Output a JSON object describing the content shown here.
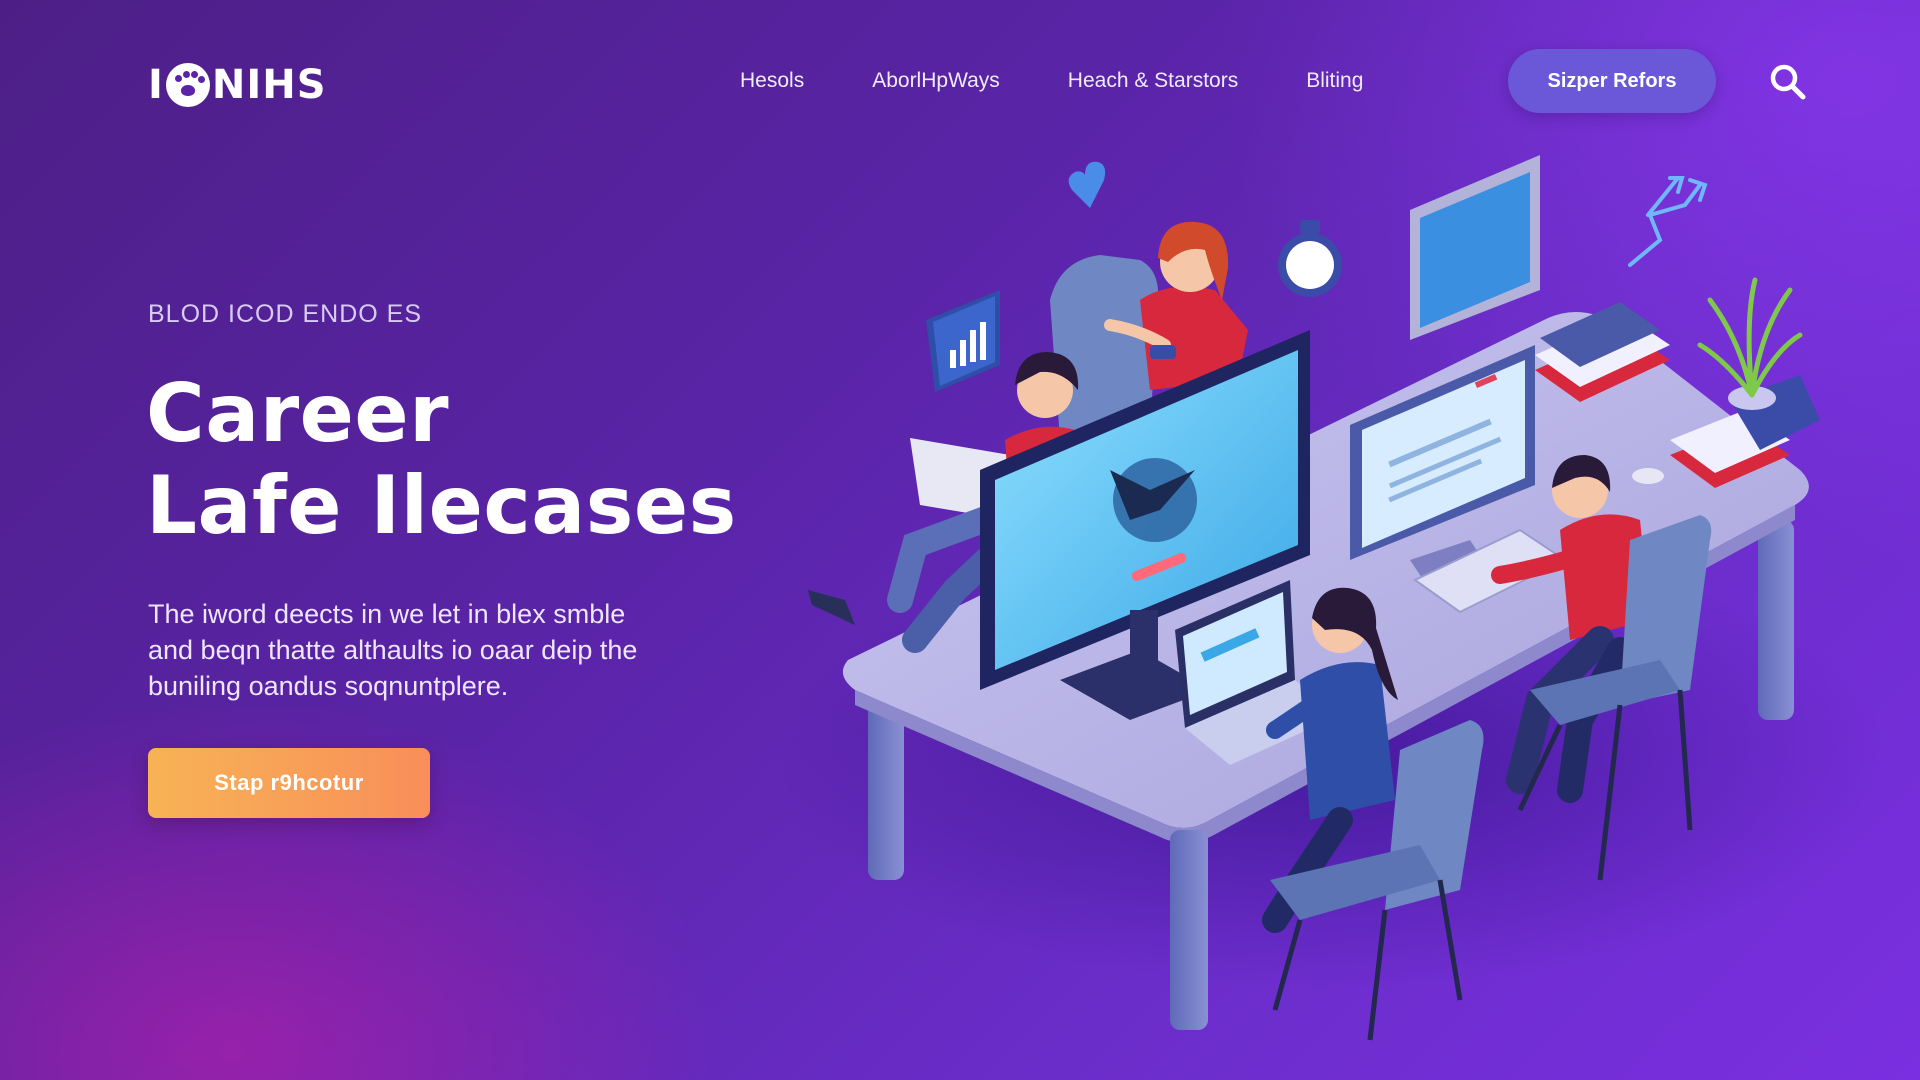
{
  "header": {
    "logo_left": "I",
    "logo_right": "NIHS",
    "nav": [
      "Hesols",
      "AborlHpWays",
      "Heach & Starstors",
      "Bliting"
    ],
    "cta_label": "Sizper Refors",
    "search_icon": "search-icon"
  },
  "hero": {
    "eyebrow": "BLOD ICOD ENDO ES",
    "title_lines": [
      "Career",
      "Lafe Ilecases"
    ],
    "description_lines": [
      "The iword deects in we let in blex smble",
      "and beqn thatte althaults io oaar deip the",
      "buniling oandus soqnuntplere."
    ],
    "cta_label": "Stap r9hcotur"
  },
  "colors": {
    "background_start": "#4d1f86",
    "background_end": "#7a2fe0",
    "accent_pink": "#c81eaa",
    "nav_button": "#6a58d8",
    "cta_gradient_start": "#f7b355",
    "cta_gradient_end": "#f98e5a",
    "desk": "#b9b6e6",
    "screen": "#5cc8f5",
    "shirt_red": "#d8283d"
  }
}
